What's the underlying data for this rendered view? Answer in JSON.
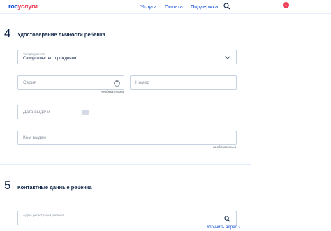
{
  "header": {
    "logo_part1": "гос",
    "logo_part2": "услуги",
    "nav": [
      "Услуги",
      "Оплата",
      "Поддержка"
    ],
    "notifications_count": "1"
  },
  "section4": {
    "number": "4",
    "title": "Удостоверение личности ребенка",
    "doc_type": {
      "label": "Тип документа",
      "value": "Свидетельство о рождении"
    },
    "series": {
      "placeholder": "Серия",
      "hint": "необязательно"
    },
    "number_field": {
      "placeholder": "Номер"
    },
    "issue_date": {
      "placeholder": "Дата выдачи"
    },
    "issued_by": {
      "placeholder": "Кем выдан",
      "hint": "необязательно"
    }
  },
  "section5": {
    "number": "5",
    "title": "Контактные данные ребенка",
    "address": {
      "label": "Адрес регистрации ребенка",
      "link": "Уточнить адрес"
    }
  },
  "colors": {
    "accent": "#0d4cd3",
    "brand_red": "#ee3f58",
    "border": "#c6d2e1",
    "text": "#0d2347"
  }
}
